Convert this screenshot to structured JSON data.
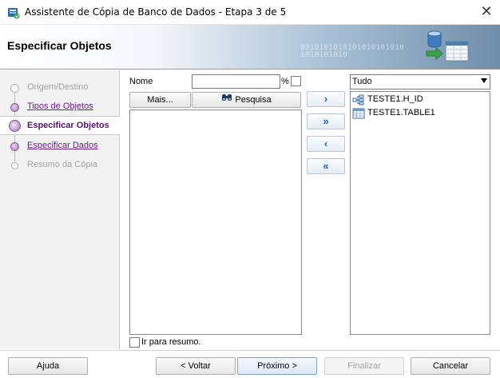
{
  "window": {
    "title": "Assistente de Cópia de Banco de Dados - Etapa 3 de 5",
    "close_glyph": "✕"
  },
  "header": {
    "title": "Especificar Objetos",
    "binary": "0010101010101010101010\n1010101010"
  },
  "sidebar": {
    "steps": [
      {
        "label": "Origem/Destino",
        "state": "done"
      },
      {
        "label": "Tipos de Objetos",
        "state": "link"
      },
      {
        "label": "Especificar Objetos",
        "state": "current"
      },
      {
        "label": "Especificar Dados",
        "state": "link"
      },
      {
        "label": "Resumo da Cópia",
        "state": "future"
      }
    ]
  },
  "filter": {
    "name_label": "Nome",
    "name_value": "",
    "percent": "%",
    "mais_label": "Mais...",
    "pesquisa_label": "Pesquisa"
  },
  "available": {
    "items": []
  },
  "transfer": {
    "add": "›",
    "add_all": "»",
    "remove": "‹",
    "remove_all": "«"
  },
  "selected": {
    "filter_value": "Tudo",
    "items": [
      {
        "label": "TESTE1.H_ID",
        "icon": "index-icon"
      },
      {
        "label": "TESTE1.TABLE1",
        "icon": "table-icon"
      }
    ]
  },
  "options": {
    "resumo_label": "Ir para resumo."
  },
  "footer": {
    "ajuda": "Ajuda",
    "voltar": "< Voltar",
    "proximo": "Próximo >",
    "finalizar": "Finalizar",
    "cancelar": "Cancelar"
  }
}
